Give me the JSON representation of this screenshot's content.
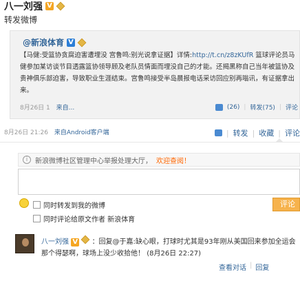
{
  "post": {
    "author": "八一刘强",
    "repost_text": "转发微博"
  },
  "origin": {
    "author": "@新浪体育",
    "text_prefix": "【马健:受篮协贪腐迫害遭埋没 宫鲁鸣:别光说拿证据】详情:",
    "link": "http://t.cn/z8zKUfR",
    "text_body": " 篮球评论员马健参加某访谈节目透露篮协领导顾及老队员情面而埋没自己的才能。还揭黑称自己当年被篮协及贵神俱乐部迫害，导致职业生涯结束。宫鲁鸣接受半岛晨报电话采访回应别再嗡讯，有证据拿出来。",
    "meta_date": "8月26日 1",
    "meta_source": "来自...",
    "likes": "(26)",
    "reposts": "转发(75)",
    "comments": "评论"
  },
  "feed": {
    "date": "8月26日 21:26",
    "source": "来自Android客户端",
    "repost": "转发",
    "collect": "收藏",
    "comment": "评论"
  },
  "notice": {
    "text": "新浪微博社区管理中心举报处理大厅，",
    "link": "欢迎查阅！"
  },
  "options": {
    "repost_to_mine": "同时转发到我的微博",
    "comment_to_origin": "同时评论给原文作者 新浪体育"
  },
  "comment_button": "评论",
  "reply": {
    "author": "八一刘强",
    "text": "：回复@于嘉:缺心眼，打球时尤其是93年刚从美国回来参加全运会那个得瑟啊，球场上没少收拾他！",
    "time": "(8月26日 22:27)",
    "view": "查看对话",
    "reply_label": "回复"
  },
  "colors": {
    "link": "#336699",
    "notice_link": "#ff6600",
    "button": "#f6b24c"
  }
}
